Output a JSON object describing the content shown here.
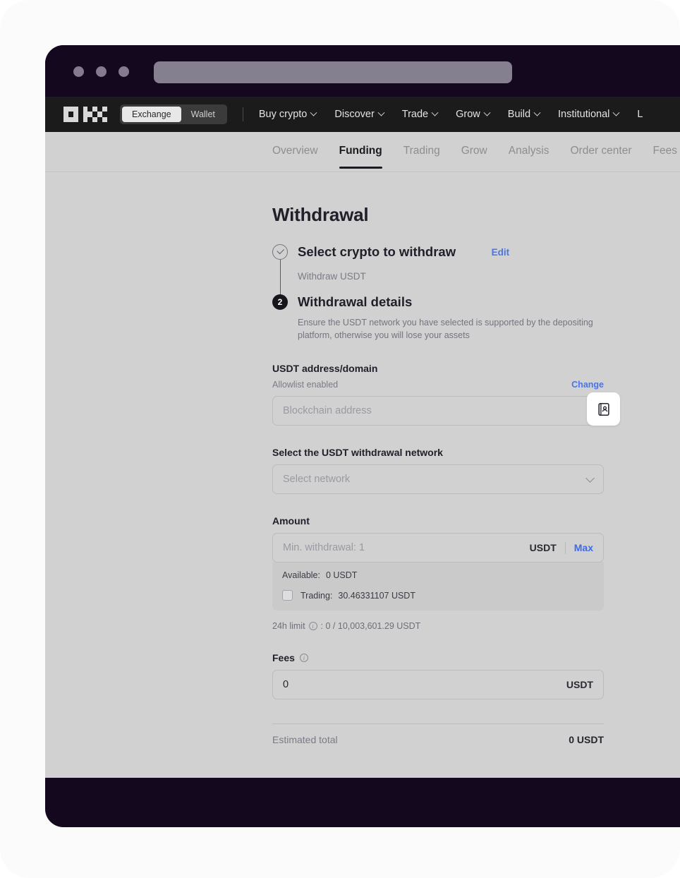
{
  "browser": {
    "traffic_lights": [
      "close-dot",
      "minimize-dot",
      "maximize-dot"
    ],
    "url_value": "",
    "url_placeholder": ""
  },
  "nav": {
    "logo_alt": "OKX",
    "mode_switch": [
      {
        "label": "Exchange",
        "active": true
      },
      {
        "label": "Wallet",
        "active": false
      }
    ],
    "links": [
      {
        "label": "Buy crypto",
        "caret": true
      },
      {
        "label": "Discover",
        "caret": true
      },
      {
        "label": "Trade",
        "caret": true
      },
      {
        "label": "Grow",
        "caret": true
      },
      {
        "label": "Build",
        "caret": true
      },
      {
        "label": "Institutional",
        "caret": true
      },
      {
        "label": "L",
        "caret": false
      }
    ]
  },
  "subtabs": [
    {
      "label": "Overview",
      "active": false
    },
    {
      "label": "Funding",
      "active": true
    },
    {
      "label": "Trading",
      "active": false
    },
    {
      "label": "Grow",
      "active": false
    },
    {
      "label": "Analysis",
      "active": false
    },
    {
      "label": "Order center",
      "active": false
    },
    {
      "label": "Fees",
      "active": false
    }
  ],
  "main": {
    "title": "Withdrawal",
    "step1": {
      "title": "Select crypto to withdraw",
      "edit_label": "Edit",
      "summary": "Withdraw USDT"
    },
    "step2": {
      "number": "2",
      "title": "Withdrawal details",
      "description": "Ensure the USDT network you have selected is supported by the depositing platform, otherwise you will lose your assets"
    },
    "address": {
      "label": "USDT address/domain",
      "sub_label": "Allowlist enabled",
      "change_label": "Change",
      "input_placeholder": "Blockchain address",
      "input_value": "",
      "book_icon": "address-book-icon"
    },
    "network": {
      "label": "Select the USDT withdrawal network",
      "placeholder": "Select network",
      "value": ""
    },
    "amount": {
      "label": "Amount",
      "placeholder": "Min. withdrawal: 1",
      "value": "",
      "currency": "USDT",
      "max_label": "Max",
      "available_label": "Available:",
      "available_value": "0 USDT",
      "trading_label": "Trading:",
      "trading_value": "30.46331107 USDT",
      "limit_text_prefix": "24h limit",
      "limit_text_suffix": ": 0 / 10,003,601.29 USDT"
    },
    "fees": {
      "label": "Fees",
      "value": "0",
      "currency": "USDT"
    },
    "total": {
      "label": "Estimated total",
      "value": "0 USDT"
    }
  },
  "colors": {
    "accent_blue": "#4a74e8",
    "nav_dark": "#1b1b1b",
    "window_dark": "#14081f",
    "page_grey": "#d1d1d1"
  }
}
